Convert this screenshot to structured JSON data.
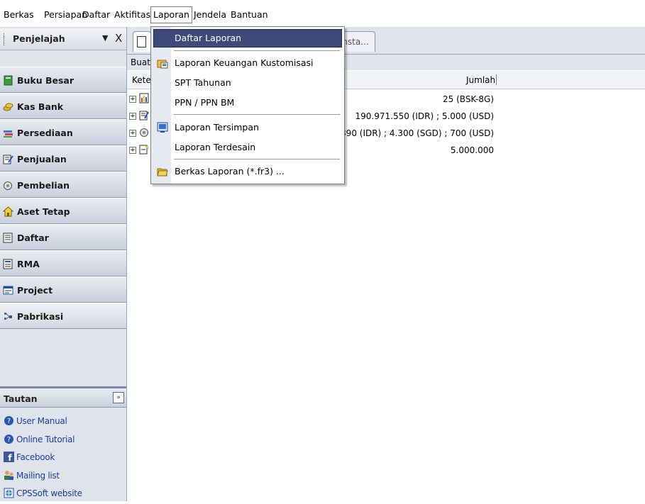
{
  "menubar": {
    "items": [
      {
        "label": "Berkas"
      },
      {
        "label": "Persiapan"
      },
      {
        "label": "Daftar"
      },
      {
        "label": "Aktifitas"
      },
      {
        "label": "Laporan"
      },
      {
        "label": "Jendela"
      },
      {
        "label": "Bantuan"
      }
    ]
  },
  "sidebar": {
    "title": "Penjelajah",
    "dropdown_glyph": "▼",
    "close_glyph": "X",
    "items": [
      {
        "label": "Buku Besar",
        "icon": "ledger-icon"
      },
      {
        "label": "Kas Bank",
        "icon": "coins-icon"
      },
      {
        "label": "Persediaan",
        "icon": "inventory-icon"
      },
      {
        "label": "Penjualan",
        "icon": "sales-icon"
      },
      {
        "label": "Pembelian",
        "icon": "purchase-icon"
      },
      {
        "label": "Aset Tetap",
        "icon": "house-icon"
      },
      {
        "label": "Daftar",
        "icon": "list-icon"
      },
      {
        "label": "RMA",
        "icon": "rma-icon"
      },
      {
        "label": "Project",
        "icon": "project-icon"
      },
      {
        "label": "Pabrikasi",
        "icon": "factory-icon"
      }
    ]
  },
  "links": {
    "title": "Tautan",
    "toggle_glyph": "»",
    "items": [
      {
        "label": "User Manual",
        "icon": "help-icon"
      },
      {
        "label": "Online Tutorial",
        "icon": "help-icon"
      },
      {
        "label": "Facebook",
        "icon": "facebook-icon"
      },
      {
        "label": "Mailing list",
        "icon": "users-icon"
      },
      {
        "label": "CPSSoft website",
        "icon": "globe-icon"
      }
    ]
  },
  "main": {
    "tab2_label": "rinsta...",
    "toolbar_label": "Buat",
    "columns": {
      "ket": "Keter",
      "jumlah": "Jumlah"
    },
    "rows": [
      {
        "value": "25 (BSK-8G)"
      },
      {
        "value": "190.971.550 (IDR) ; 5.000 (USD)"
      },
      {
        "value": "7.634.890 (IDR) ; 4.300 (SGD) ; 700 (USD)"
      },
      {
        "value": "5.000.000"
      }
    ]
  },
  "dropdown": {
    "items": [
      {
        "label": "Daftar Laporan",
        "highlighted": true
      },
      {
        "label": "Laporan Keuangan Kustomisasi"
      },
      {
        "label": "SPT Tahunan"
      },
      {
        "label": "PPN / PPN BM"
      },
      {
        "label": "Laporan Tersimpan"
      },
      {
        "label": "Laporan Terdesain"
      },
      {
        "label": "Berkas Laporan (*.fr3) ..."
      }
    ]
  },
  "colors": {
    "sidebar_bg": "#dfe3ec",
    "highlight": "#3e4a7a",
    "link": "#1f3f99"
  }
}
